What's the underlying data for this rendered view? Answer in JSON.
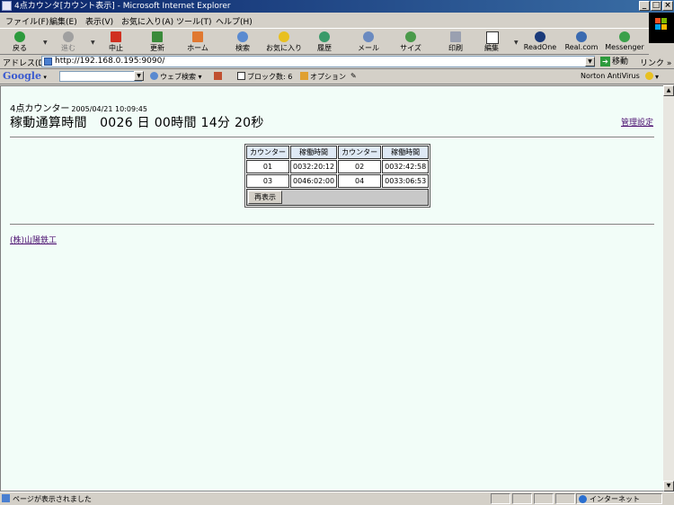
{
  "window": {
    "title": "4点カウンタ[カウント表示] - Microsoft Internet Explorer",
    "minimize": "_",
    "maximize": "□",
    "close": "×"
  },
  "menu": {
    "items": [
      "ファイル(F)",
      "編集(E)",
      "表示(V)",
      "お気に入り(A)",
      "ツール(T)",
      "ヘルプ(H)"
    ]
  },
  "toolbar": {
    "back": "戻る",
    "forward": "進む",
    "stop": "中止",
    "refresh": "更新",
    "home": "ホーム",
    "search": "検索",
    "favorites": "お気に入り",
    "history": "履歴",
    "mail": "メール",
    "size": "サイズ",
    "print": "印刷",
    "edit": "編集",
    "readone": "ReadOne",
    "realcom": "Real.com",
    "messenger": "Messenger"
  },
  "address": {
    "label": "アドレス(D)",
    "url": "http://192.168.0.195:9090/",
    "go": "移動",
    "links": "リンク"
  },
  "googlebar": {
    "logo": "Google",
    "web_search": "ウェブ検索",
    "popup_blocked": "ブロック数: 6",
    "options": "オプション",
    "norton": "Norton AntiVirus"
  },
  "page": {
    "heading_small": "4点カウンター",
    "timestamp": "2005/04/21 10:09:45",
    "heading_large": "稼動通算時間　0026 日 00時間 14分 20秒",
    "admin_link": "管理設定",
    "table": {
      "headers": [
        "カウンター",
        "稼働時間",
        "カウンター",
        "稼働時間"
      ],
      "rows": [
        [
          "01",
          "0032:20:12",
          "02",
          "0032:42:58"
        ],
        [
          "03",
          "0046:02:00",
          "04",
          "0033:06:53"
        ]
      ],
      "redisplay": "再表示"
    },
    "company_link": "(株)山陽鉄工"
  },
  "status": {
    "text": "ページが表示されました",
    "zone": "インターネット"
  },
  "colors": {
    "titlebar_start": "#0a246a",
    "titlebar_end": "#3a6ea5",
    "page_background": "#f2fdf8",
    "visited_link": "#4b0f70",
    "table_header": "#dfe9f5"
  }
}
